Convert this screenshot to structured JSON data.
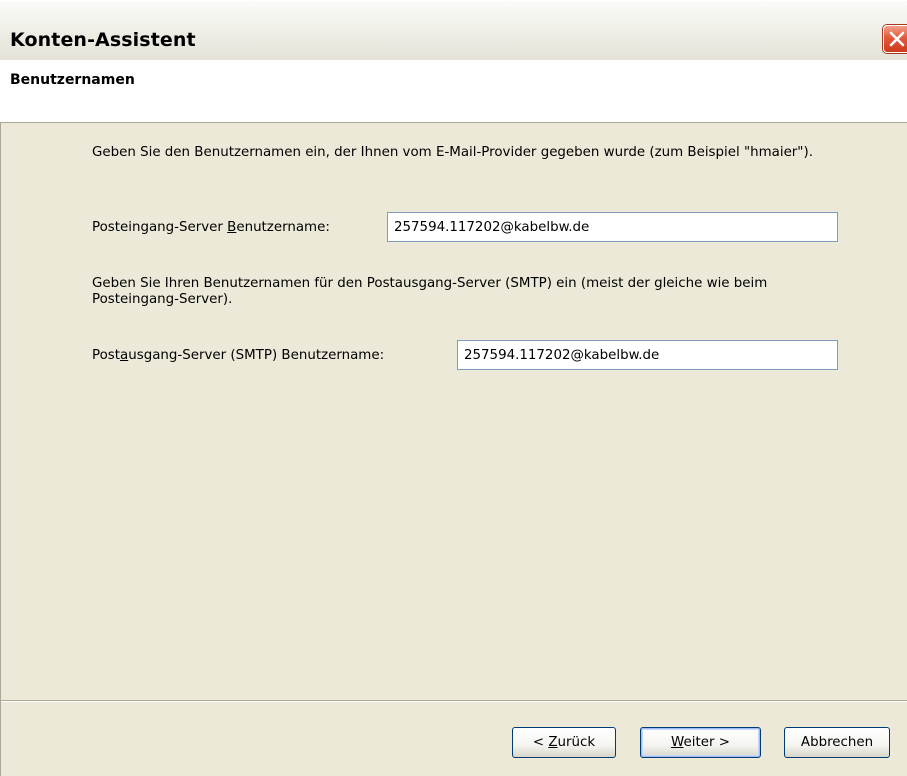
{
  "window": {
    "title": "Konten-Assistent"
  },
  "header": {
    "page_title": "Benutzernamen"
  },
  "incoming": {
    "description": "Geben Sie den Benutzernamen ein, der Ihnen vom E-Mail-Provider gegeben wurde (zum Beispiel \"hmaier\").",
    "label_prefix": "Posteingang-Server ",
    "label_accel": "B",
    "label_suffix": "enutzername:",
    "value": "257594.117202@kabelbw.de"
  },
  "outgoing": {
    "description": "Geben Sie Ihren Benutzernamen für den Postausgang-Server (SMTP) ein (meist der gleiche wie beim Posteingang-Server).",
    "label_prefix": "Post",
    "label_accel": "a",
    "label_suffix": "usgang-Server (SMTP) Benutzername:",
    "value": "257594.117202@kabelbw.de"
  },
  "buttons": {
    "back_prefix": "< ",
    "back_accel": "Z",
    "back_suffix": "urück",
    "next_accel": "W",
    "next_suffix": "eiter >",
    "cancel": "Abbrechen"
  },
  "icons": {
    "close": "close-icon"
  },
  "colors": {
    "dialog_face": "#ece9d8",
    "close_button": "#e2593c",
    "input_border": "#7f9db9",
    "button_border": "#003c74"
  }
}
